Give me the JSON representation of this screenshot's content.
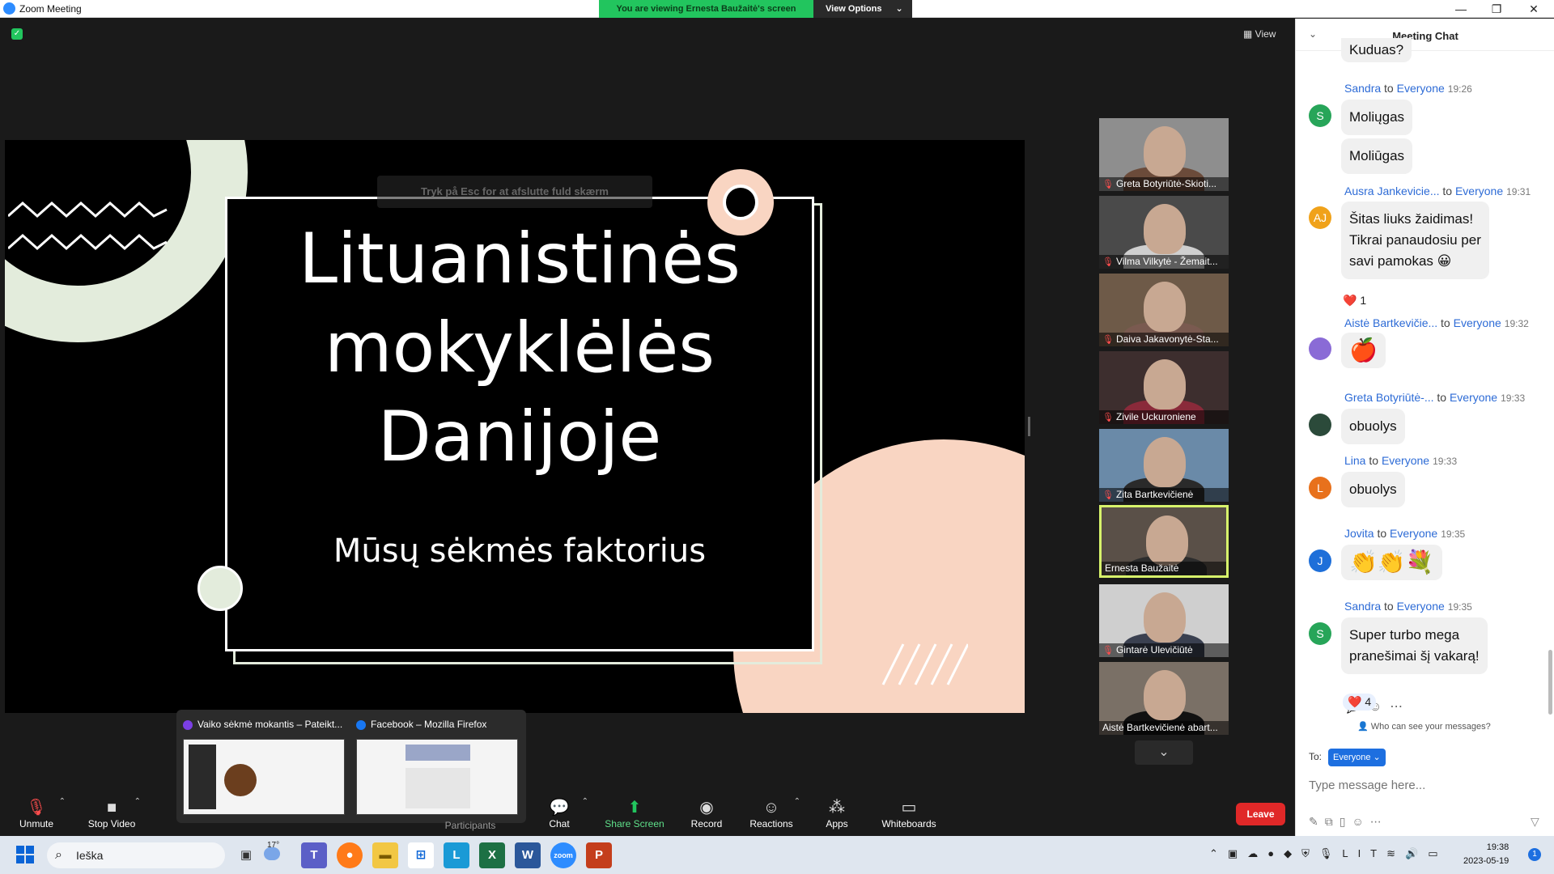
{
  "window": {
    "title": "Zoom Meeting",
    "minimize": "—",
    "maximize": "❐",
    "close": "✕"
  },
  "banner": {
    "viewing": "You are viewing Ernesta Baužaitė's screen",
    "view_options": "View Options"
  },
  "meeting": {
    "view_label": "View",
    "esc_hint": "Tryk på  Esc  for at afslutte fuld skærm"
  },
  "slide": {
    "title_line1": "Lituanistinės",
    "title_line2": "mokyklėlės",
    "title_line3": "Danijoje",
    "subtitle": "Mūsų sėkmės faktorius"
  },
  "participants": [
    {
      "name": "Greta Botyriūtė-Skioti...",
      "muted": true,
      "shirt": "#6b4b3a",
      "bg": "#8e8e8e"
    },
    {
      "name": "Vilma Vilkytė - Žemait...",
      "muted": true,
      "shirt": "#cfcfcf",
      "bg": "#4a4a4a"
    },
    {
      "name": "Daiva Jakavonytė-Sta...",
      "muted": true,
      "shirt": "#7a5a50",
      "bg": "#6e5a48"
    },
    {
      "name": "Zivile Uckuroniene",
      "muted": true,
      "shirt": "#8a2a3a",
      "bg": "#3d2e2e"
    },
    {
      "name": "Zita Bartkevičienė",
      "muted": true,
      "shirt": "#2a2a2a",
      "bg": "#6a8aa8"
    },
    {
      "name": "Ernesta Baužaitė",
      "muted": false,
      "shirt": "#2d2d2d",
      "bg": "#5a5048"
    },
    {
      "name": "Gintarė Ulevičiūtė",
      "muted": true,
      "shirt": "#3a4050",
      "bg": "#cfcfcf"
    },
    {
      "name": "Aistė Bartkevičienė abart...",
      "muted": false,
      "shirt": "#111111",
      "bg": "#7a7066"
    }
  ],
  "toolbar": {
    "unmute": "Unmute",
    "stop_video": "Stop Video",
    "participants": "Participants",
    "chat": "Chat",
    "share_screen": "Share Screen",
    "record": "Record",
    "reactions": "Reactions",
    "apps": "Apps",
    "whiteboards": "Whiteboards",
    "leave": "Leave"
  },
  "preview": [
    {
      "title": "Vaiko sėkmė mokantis – Pateikt...",
      "icon_color": "#7b3fe4"
    },
    {
      "title": "Facebook – Mozilla Firefox",
      "icon_color": "#1877f2"
    }
  ],
  "chat": {
    "title": "Meeting Chat",
    "partial_top": "Kuduas?",
    "messages": [
      {
        "sender": "Sandra",
        "to": "Everyone",
        "time": "19:26",
        "avatar": "S",
        "avatar_color": "#27a559",
        "lines": [
          "Moliųgas"
        ],
        "extra": "Moliūgas"
      },
      {
        "sender": "Ausra Jankevicie...",
        "to": "Everyone",
        "time": "19:31",
        "avatar": "AJ",
        "avatar_color": "#f0a21a",
        "lines": [
          "Šitas liuks žaidimas!",
          "Tikrai panaudosiu per",
          "savi pamokas 😀"
        ],
        "reaction": "❤️ 1"
      },
      {
        "sender": "Aistė Bartkevičie...",
        "to": "Everyone",
        "time": "19:32",
        "avatar": "",
        "avatar_color": "#8a6bd6",
        "lines": [
          "🍎"
        ]
      },
      {
        "sender": "Greta Botyriūtė-...",
        "to": "Everyone",
        "time": "19:33",
        "avatar": "",
        "avatar_color": "#2b4a3a",
        "lines": [
          "obuolys"
        ]
      },
      {
        "sender": "Lina",
        "to": "Everyone",
        "time": "19:33",
        "avatar": "L",
        "avatar_color": "#e8711c",
        "lines": [
          "obuolys"
        ]
      },
      {
        "sender": "Jovita",
        "to": "Everyone",
        "time": "19:35",
        "avatar": "J",
        "avatar_color": "#1e6fd9",
        "lines": [
          "👏👏💐"
        ]
      },
      {
        "sender": "Sandra",
        "to": "Everyone",
        "time": "19:35",
        "avatar": "S",
        "avatar_color": "#27a559",
        "lines": [
          "Super turbo mega",
          "pranešimai šį vakarą!"
        ],
        "reaction": "❤️ 4"
      }
    ],
    "to_word": "to",
    "who_sees": "Who can see your messages?",
    "to_label": "To:",
    "to_value": "Everyone",
    "input_placeholder": "Type message here..."
  },
  "taskbar": {
    "search": "Ieška",
    "weather_temp": "17°",
    "lang": "LIT",
    "time": "19:38",
    "date": "2023-05-19",
    "notifications": "1"
  }
}
